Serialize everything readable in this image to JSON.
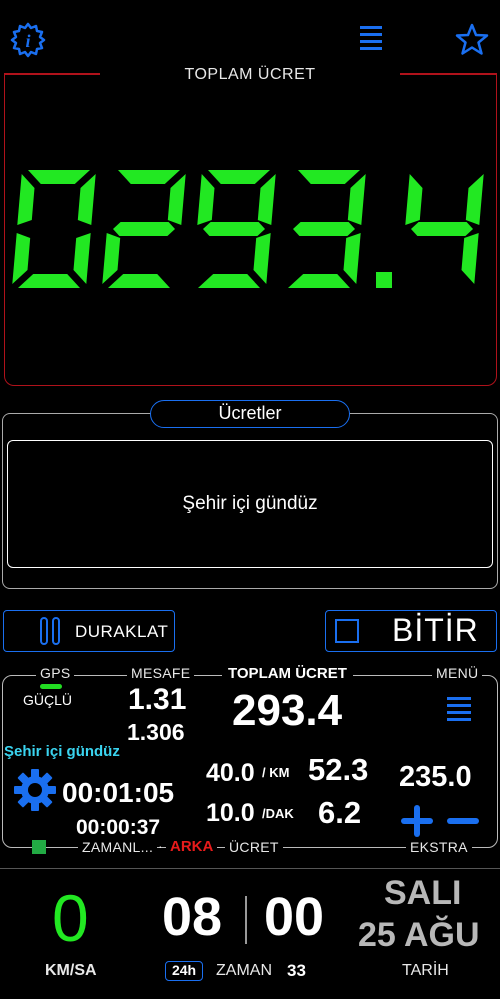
{
  "top_bar": {
    "info_icon": "info-icon",
    "menu_icon": "hamburger-icon",
    "star_icon": "star-icon"
  },
  "fare": {
    "label": "TOPLAM ÜCRET",
    "digits": "0293.4",
    "color": "#22e822"
  },
  "tariffs": {
    "title": "Ücretler",
    "selected": "Şehir içi gündüz"
  },
  "buttons": {
    "pause": "DURAKLAT",
    "finish": "BİTİR"
  },
  "info": {
    "gps_label": "GPS",
    "gps_status": "GÜÇLÜ",
    "distance_label": "MESAFE",
    "distance": "1.31",
    "distance_sub": "1.306",
    "total_label": "TOPLAM ÜCRET",
    "total": "293.4",
    "menu_label": "MENÜ",
    "tariff_name": "Şehir içi gündüz",
    "elapsed": "00:01:05",
    "waiting": "00:00:37",
    "per_km_rate": "40.0",
    "per_km_unit": "/ KM",
    "per_km_amount": "52.3",
    "per_min_rate": "10.0",
    "per_min_unit": "/DAK",
    "per_min_amount": "6.2",
    "extra": "235.0",
    "timer_label": "ZAMANL...",
    "dot_sep": "·",
    "background_label": "ARKA",
    "fare_label": "ÜCRET",
    "extra_label": "EKSTRA"
  },
  "bottom": {
    "speed": "0",
    "speed_unit": "KM/SA",
    "hours": "08",
    "minutes": "00",
    "time_format": "24h",
    "time_label": "ZAMAN",
    "seconds": "33",
    "day": "SALI",
    "date": "25 AĞU",
    "date_label": "TARİH"
  }
}
